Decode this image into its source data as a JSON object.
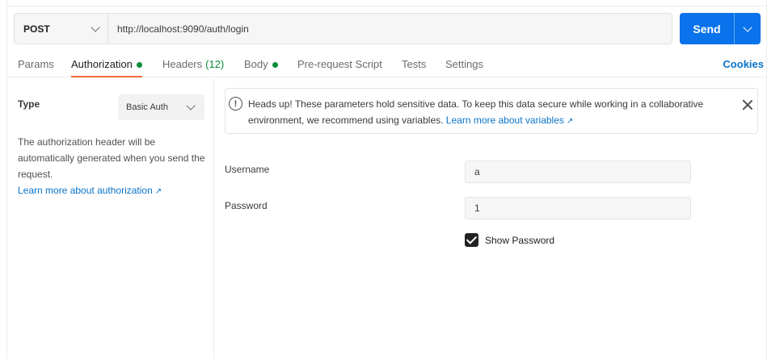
{
  "request": {
    "method": "POST",
    "url": "http://localhost:9090/auth/login",
    "send_label": "Send"
  },
  "tabs": [
    {
      "label": "Params"
    },
    {
      "label": "Authorization",
      "active": true,
      "dot": true
    },
    {
      "label": "Headers",
      "count": "(12)"
    },
    {
      "label": "Body",
      "dot": true
    },
    {
      "label": "Pre-request Script"
    },
    {
      "label": "Tests"
    },
    {
      "label": "Settings"
    }
  ],
  "cookies_label": "Cookies",
  "auth": {
    "type_label": "Type",
    "type_value": "Basic Auth",
    "description": "The authorization header will be automatically generated when you send the request.",
    "learn_more": "Learn more about authorization",
    "arrow": "↗"
  },
  "notice": {
    "text": "Heads up! These parameters hold sensitive data. To keep this data secure while working in a collaborative environment, we recommend using variables.",
    "link": "Learn more about variables",
    "icon": "!"
  },
  "fields": {
    "username_label": "Username",
    "username_value": "a",
    "password_label": "Password",
    "password_value": "1",
    "show_password_label": "Show Password",
    "show_password_checked": true
  },
  "colors": {
    "send": "#0a73eb",
    "active_tab_underline": "#f26b3a",
    "status_dot": "#0c8c3a",
    "link": "#0a73c8"
  }
}
